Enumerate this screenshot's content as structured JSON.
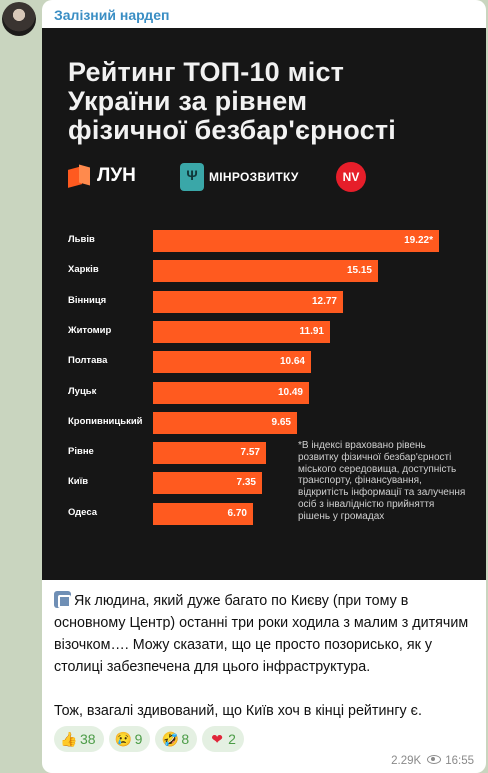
{
  "message": {
    "sender": "Залізний нардеп",
    "poster": {
      "title_lines": [
        "Рейтинг ТОП-10 міст",
        "України за рівнем",
        "фізичної безбар'єрності"
      ],
      "logos": {
        "lun": "ЛУН",
        "ministry": "МІНРОЗВИТКУ",
        "nv": "NV",
        "ministry_glyph": "Ψ"
      },
      "accent_color": "#ff5a1f",
      "footnote": "*В індексі враховано рівень розвитку фізичної безбар'єрності міського середовища, доступність транспорту, фінансування, відкритість інформації та залучення осіб з інвалідністю прийняття рішень у громадах"
    },
    "chart_data": {
      "type": "bar",
      "orientation": "horizontal",
      "categories": [
        "Львів",
        "Харків",
        "Вінниця",
        "Житомир",
        "Полтава",
        "Луцьк",
        "Кропивницький",
        "Рівне",
        "Київ",
        "Одеса"
      ],
      "values": [
        19.22,
        15.15,
        12.77,
        11.91,
        10.64,
        10.49,
        9.65,
        7.57,
        7.35,
        6.7
      ],
      "data_labels": [
        "19.22*",
        "15.15",
        "12.77",
        "11.91",
        "10.64",
        "10.49",
        "9.65",
        "7.57",
        "7.35",
        "6.70"
      ],
      "xlim": [
        0,
        19.22
      ],
      "title": "Рейтинг ТОП-10 міст України за рівнем фізичної безбар'єрності",
      "xlabel": "",
      "ylabel": ""
    },
    "caption": {
      "paragraph1": "Як людина, який дуже багато по Києву (при тому в основному Центр) останні три роки ходила з малим з дитячим візочком…. Можу сказати, що це просто позорисько, як у столиці забезпечена для цього інфраструктура.",
      "paragraph2": "Тож, взагалі здивований, що Київ хоч в кінці рейтингу є."
    },
    "reactions": [
      {
        "emoji": "👍",
        "count": "38"
      },
      {
        "emoji": "😢",
        "count": "9"
      },
      {
        "emoji": "🤣",
        "count": "8"
      },
      {
        "emoji": "❤",
        "count": "2"
      }
    ],
    "views": "2.29K",
    "time": "16:55"
  }
}
